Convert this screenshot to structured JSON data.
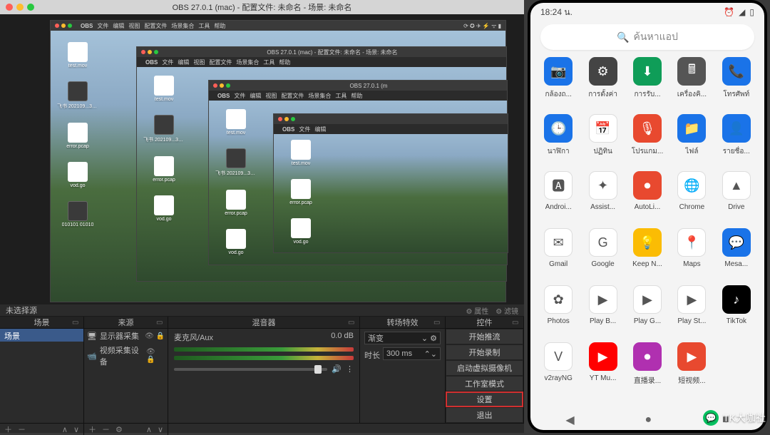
{
  "obs": {
    "title": "OBS 27.0.1 (mac) - 配置文件: 未命名 - 场景: 未命名",
    "mac_menu": [
      "OBS",
      "文件",
      "编辑",
      "视图",
      "配置文件",
      "场景集合",
      "工具",
      "帮助"
    ],
    "nested_title": "OBS 27.0.1 (mac) - 配置文件: 未命名 - 场景: 未命名",
    "desk_files": [
      "test.mov",
      "飞书\n202109...3649.png",
      "error.pcap",
      "vod.go",
      "010101\n01010"
    ],
    "no_source": "未选择源",
    "props": "⚙ 属性",
    "filters": "⚙ 滤镜",
    "panel_heads": {
      "scene": "场景",
      "source": "来源",
      "mixer": "混音器",
      "trans": "转场特效",
      "ctrl": "控件"
    },
    "scene_item": "场景",
    "sources": [
      {
        "label": "显示器采集",
        "icon": "display"
      },
      {
        "label": "视频采集设备",
        "icon": "camera"
      }
    ],
    "mixer": {
      "name": "麦克风/Aux",
      "db": "0.0 dB"
    },
    "trans": {
      "type": "渐变",
      "dur_label": "时长",
      "dur_val": "300 ms"
    },
    "controls": [
      "开始推流",
      "开始录制",
      "启动虚拟摄像机",
      "工作室模式",
      "设置",
      "退出"
    ],
    "highlight_index": 4
  },
  "phone": {
    "time": "18:24 น.",
    "search_placeholder": "ค้นหาแอป",
    "apps": [
      {
        "label": "กล้องถ...",
        "bg": "#1a73e8",
        "glyph": "📷"
      },
      {
        "label": "การตั้งค่า",
        "bg": "#444",
        "glyph": "⚙"
      },
      {
        "label": "การรับ...",
        "bg": "#0f9d58",
        "glyph": "⬇"
      },
      {
        "label": "เครื่องคิ...",
        "bg": "#555",
        "glyph": "🖩"
      },
      {
        "label": "โทรศัพท์",
        "bg": "#1a73e8",
        "glyph": "📞"
      },
      {
        "label": "นาฬิกา",
        "bg": "#1a73e8",
        "glyph": "🕒"
      },
      {
        "label": "ปฏิทิน",
        "bg": "#fff",
        "glyph": "📅"
      },
      {
        "label": "โปรแกม...",
        "bg": "#e8492f",
        "glyph": "🎙"
      },
      {
        "label": "ไฟล์",
        "bg": "#1a73e8",
        "glyph": "📁"
      },
      {
        "label": "รายชื่อ...",
        "bg": "#1a73e8",
        "glyph": "👤"
      },
      {
        "label": "Androi...",
        "bg": "#fff",
        "glyph": "🅰"
      },
      {
        "label": "Assist...",
        "bg": "#fff",
        "glyph": "✦"
      },
      {
        "label": "AutoLi...",
        "bg": "#e8492f",
        "glyph": "⏺"
      },
      {
        "label": "Chrome",
        "bg": "#fff",
        "glyph": "🌐"
      },
      {
        "label": "Drive",
        "bg": "#fff",
        "glyph": "▲"
      },
      {
        "label": "Gmail",
        "bg": "#fff",
        "glyph": "✉"
      },
      {
        "label": "Google",
        "bg": "#fff",
        "glyph": "G"
      },
      {
        "label": "Keep N...",
        "bg": "#fbbc04",
        "glyph": "💡"
      },
      {
        "label": "Maps",
        "bg": "#fff",
        "glyph": "📍"
      },
      {
        "label": "Mesa...",
        "bg": "#1a73e8",
        "glyph": "💬"
      },
      {
        "label": "Photos",
        "bg": "#fff",
        "glyph": "✿"
      },
      {
        "label": "Play B...",
        "bg": "#fff",
        "glyph": "▶"
      },
      {
        "label": "Play G...",
        "bg": "#fff",
        "glyph": "▶"
      },
      {
        "label": "Play St...",
        "bg": "#fff",
        "glyph": "▶"
      },
      {
        "label": "TikTok",
        "bg": "#000",
        "glyph": "♪"
      },
      {
        "label": "v2rayNG",
        "bg": "#fff",
        "glyph": "V"
      },
      {
        "label": "YT Mu...",
        "bg": "#f00",
        "glyph": "▶"
      },
      {
        "label": "直播录...",
        "bg": "#b030b0",
        "glyph": "⏺"
      },
      {
        "label": "短视频...",
        "bg": "#e8492f",
        "glyph": "▶"
      }
    ]
  },
  "watermark": "TK大咖社"
}
